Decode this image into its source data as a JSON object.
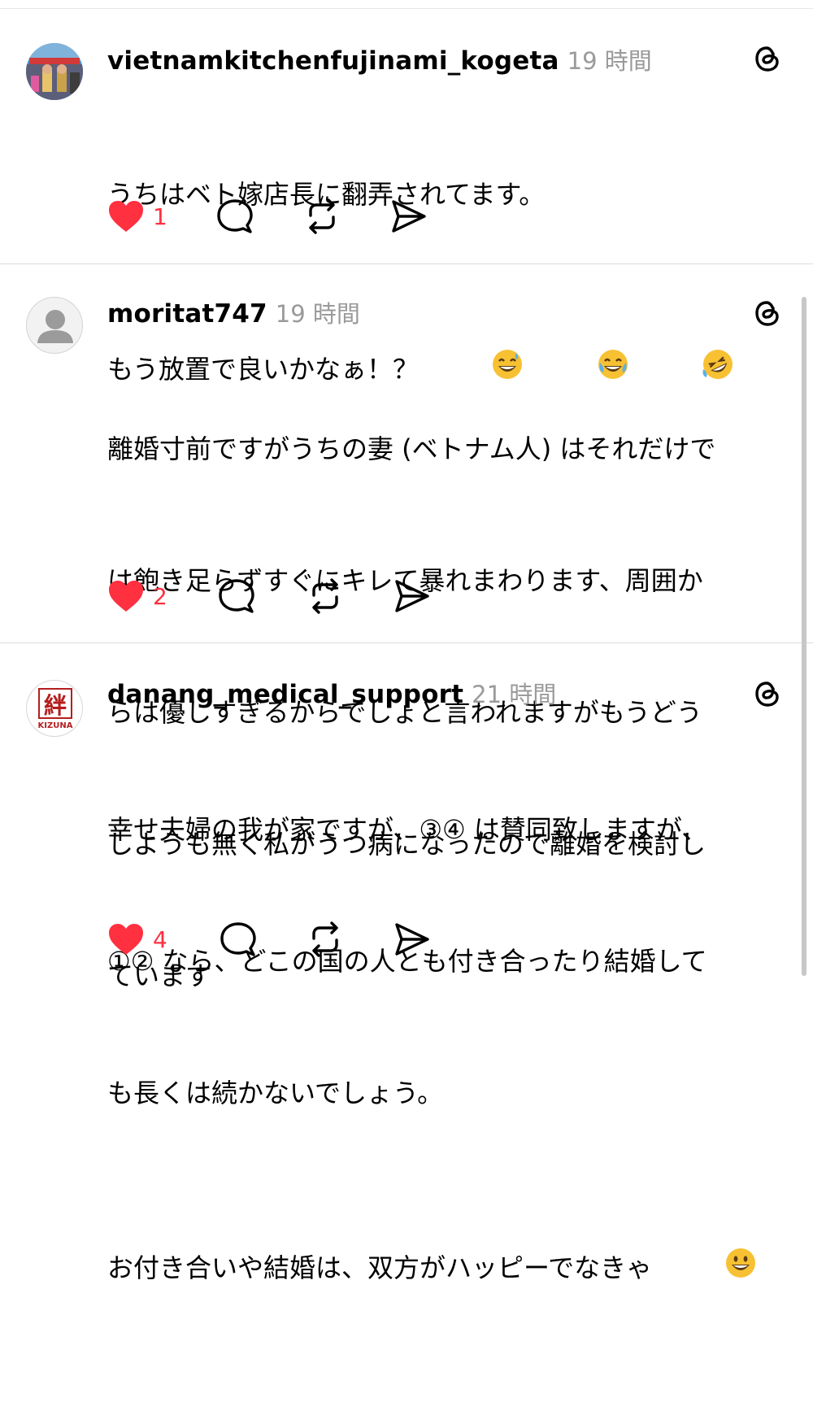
{
  "posts": [
    {
      "username": "vietnamkitchenfujinami_kogeta",
      "time": "19 時間",
      "lines": [
        "うちはベト嫁店長に翻弄されてます。",
        "もう放置で良いかなぁ！？"
      ],
      "emojis": [
        "grinning-sweat-emoji",
        "tears-of-joy-emoji",
        "rolling-on-floor-laughing-emoji"
      ],
      "likes": "1"
    },
    {
      "username": "moritat747",
      "time": "19 時間",
      "lines": [
        "離婚寸前ですがうちの妻 (ベトナム人) はそれだけで",
        "は飽き足らずすぐにキレて暴れまわります、周囲か",
        "らは優しすぎるからでしょと言われますがもうどう",
        "しようも無く私がうつ病になったので離婚を検討し",
        "ています"
      ],
      "likes": "2"
    },
    {
      "username": "danang_medical_support",
      "time": "21 時間",
      "avatar_text": "絆",
      "avatar_sub": "KIZUNA",
      "lines": [
        "幸せ夫婦の我が家ですが、③④ は賛同致しますが、",
        "①② なら、どこの国の人とも付き合ったり結婚して",
        "も長くは続かないでしょう。",
        "お付き合いや結婚は、双方がハッピーでなきゃ"
      ],
      "emojis": [
        "grinning-emoji"
      ],
      "likes": "4"
    }
  ],
  "colors": {
    "like": "#ff3040",
    "time": "#9a9a9a",
    "divider": "#dcdcdc"
  }
}
